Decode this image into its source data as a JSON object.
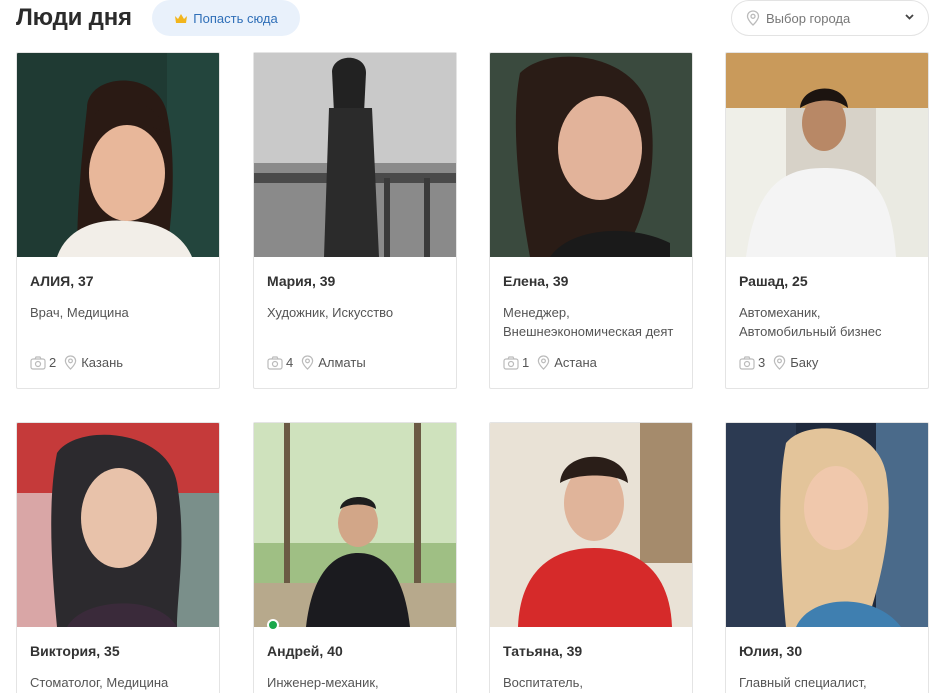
{
  "header": {
    "title": "Люди дня",
    "promo_label": "Попасть сюда",
    "city_placeholder": "Выбор города"
  },
  "cards": [
    {
      "name": "АЛИЯ, 37",
      "job_line1": "Врач, Медицина",
      "job_line2": "",
      "photos": "2",
      "city": "Казань",
      "online": false
    },
    {
      "name": "Мария, 39",
      "job_line1": "Художник, Искусство",
      "job_line2": "",
      "photos": "4",
      "city": "Алматы",
      "online": false
    },
    {
      "name": "Елена, 39",
      "job_line1": "Менеджер,",
      "job_line2": "Внешнеэкономическая деят",
      "photos": "1",
      "city": "Астана",
      "online": false
    },
    {
      "name": "Рашад, 25",
      "job_line1": "Автомеханик,",
      "job_line2": "Автомобильный бизнес",
      "photos": "3",
      "city": "Баку",
      "online": false
    },
    {
      "name": "Виктория, 35",
      "job_line1": "Стоматолог, Медицина",
      "job_line2": "",
      "photos": "",
      "city": "",
      "online": false
    },
    {
      "name": "Андрей, 40",
      "job_line1": "Инженер-механик,",
      "job_line2": "",
      "photos": "",
      "city": "",
      "online": true
    },
    {
      "name": "Татьяна, 39",
      "job_line1": "Воспитатель,",
      "job_line2": "",
      "photos": "",
      "city": "",
      "online": false
    },
    {
      "name": "Юлия, 30",
      "job_line1": "Главный специалист,",
      "job_line2": "",
      "photos": "",
      "city": "",
      "online": false
    }
  ],
  "colors": {
    "accent": "#2f6fb8",
    "promo_bg": "#e9f1fb",
    "crown": "#f2b51c",
    "online": "#1aa84b"
  }
}
